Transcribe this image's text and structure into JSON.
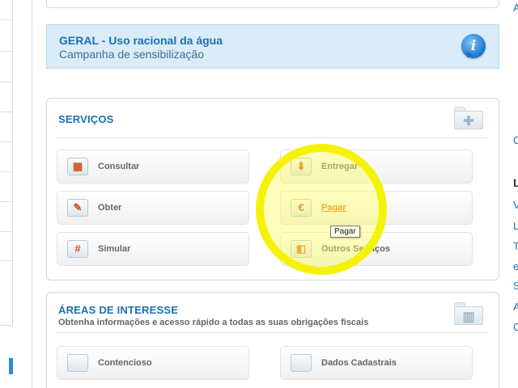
{
  "banner": {
    "title": "GERAL - Uso racional da água",
    "subtitle": "Campanha de sensibilização",
    "icon": "info-icon"
  },
  "services": {
    "title": "SERVIÇOS",
    "items": [
      {
        "label": "Consultar",
        "icon": "grid-document-icon",
        "glyph": "▦",
        "color": "#d2541c"
      },
      {
        "label": "Entregar",
        "icon": "down-arrow-icon",
        "glyph": "⬇",
        "color": "#e05a12"
      },
      {
        "label": "Obter",
        "icon": "paperclip-icon",
        "glyph": "✎",
        "color": "#d2541c"
      },
      {
        "label": "Pagar",
        "icon": "euro-icon",
        "glyph": "€",
        "color": "#d2541c"
      },
      {
        "label": "Simular",
        "icon": "hash-icon",
        "glyph": "#",
        "color": "#d2541c"
      },
      {
        "label": "Outros Serviços",
        "icon": "boxes-icon",
        "glyph": "◧",
        "color": "#e0791a"
      }
    ],
    "tooltip": "Pagar"
  },
  "areas": {
    "title": "ÁREAS DE INTERESSE",
    "subtitle": "Obtenha informações e acesso rápido a todas as suas obrigações fiscais",
    "items": [
      {
        "label": "Contencioso",
        "icon": "folder-icon"
      },
      {
        "label": "Dados Cadastrais",
        "icon": "folder-icon"
      }
    ]
  },
  "right_column": {
    "letters": [
      "A",
      "C",
      "L",
      "V",
      "L",
      "T",
      "e",
      "S",
      "A",
      "C"
    ]
  }
}
